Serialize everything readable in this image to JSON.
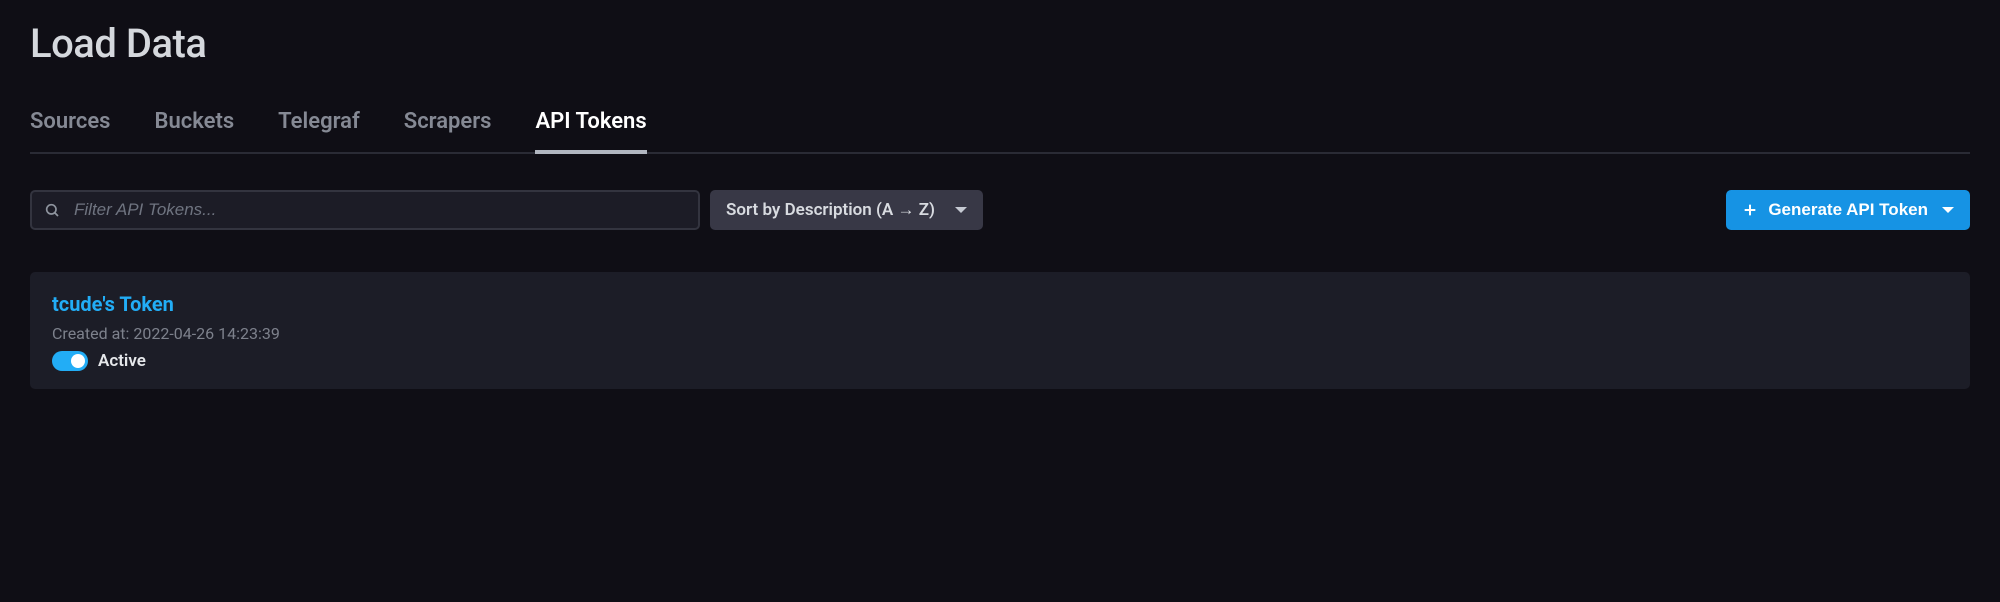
{
  "page": {
    "title": "Load Data"
  },
  "tabs": [
    {
      "label": "Sources",
      "active": false
    },
    {
      "label": "Buckets",
      "active": false
    },
    {
      "label": "Telegraf",
      "active": false
    },
    {
      "label": "Scrapers",
      "active": false
    },
    {
      "label": "API Tokens",
      "active": true
    }
  ],
  "controls": {
    "search_placeholder": "Filter API Tokens...",
    "sort_label": "Sort by Description (A → Z)",
    "generate_label": "Generate API Token"
  },
  "tokens": [
    {
      "name": "tcude's Token",
      "created_at": "Created at: 2022-04-26 14:23:39",
      "status_label": "Active",
      "active": true
    }
  ]
}
